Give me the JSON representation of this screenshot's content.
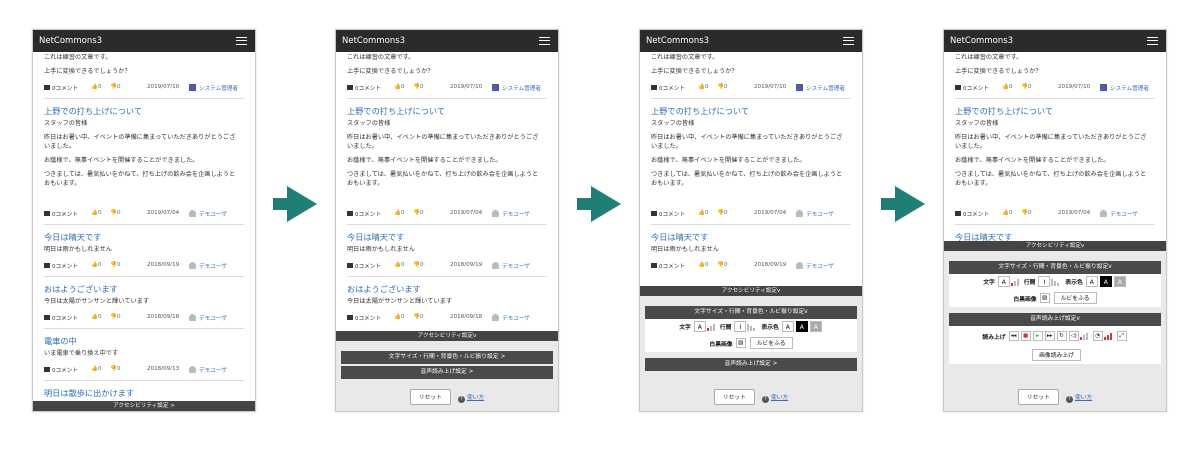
{
  "app": {
    "title": "NetCommons3"
  },
  "posts_top": [
    "これは練習の文章です。",
    "上手に変換できるでしょうか？"
  ],
  "post1_meta": {
    "comments": "0コメント",
    "likes": "0",
    "dislikes": "0",
    "date": "2019/07/10",
    "user": "システム管理者"
  },
  "post2": {
    "title": "上野での打ち上げについて",
    "sub": "スタッフの皆様",
    "lines": [
      "昨日はお暑い中、イベントの準備に集まっていただきありがとうござ",
      "いました。",
      "お蔭様で、無事イベントを開催することができました。",
      "つきましては、暑気払いをかねて、打ち上げの飲み会を企画しようと",
      "おもいます。"
    ],
    "meta": {
      "comments": "0コメント",
      "likes": "0",
      "dislikes": "0",
      "date": "2019/07/04",
      "user": "デモユーザ"
    }
  },
  "post3": {
    "title": "今日は晴天です",
    "sub": "明日は雨かもしれません",
    "meta": {
      "comments": "0コメント",
      "likes": "0",
      "dislikes": "0",
      "date": "2018/09/19",
      "user": "デモユーザ"
    }
  },
  "post4": {
    "title": "おはようございます",
    "sub": "今日は太陽がサンサンと輝いています",
    "meta": {
      "comments": "0コメント",
      "likes": "0",
      "dislikes": "0",
      "date": "2018/09/18",
      "user": "デモユーザ"
    }
  },
  "post5": {
    "title": "電車の中",
    "sub": "いま電車で乗り換え中です",
    "meta": {
      "comments": "0コメント",
      "likes": "0",
      "dislikes": "0",
      "date": "2018/09/13",
      "user": "デモユーザ"
    }
  },
  "post6": {
    "title": "明日は散歩に出かけます"
  },
  "a11y": {
    "bar_collapsed": "アクセシビリティ設定 >",
    "bar_open": "アクセシビリティ設定v",
    "font_menu": "文字サイズ・行間・背景色・ルビ振り設定 >",
    "font_menu_open": "文字サイズ・行間・背景色・ルビ振り設定v",
    "speech_menu": "音声読み上げ設定 >",
    "speech_menu_open": "音声読み上げ設定v",
    "font_label": "文字",
    "line_label": "行間",
    "color_label": "表示色",
    "color_a": "A",
    "image_label": "白黒画像",
    "ruby_button": "ルビをふる",
    "read_label": "読み上げ",
    "image_read_button": "画像読み上げ",
    "reset": "リセット",
    "howto": "使い方",
    "font_a": "A",
    "line_t": "I"
  }
}
